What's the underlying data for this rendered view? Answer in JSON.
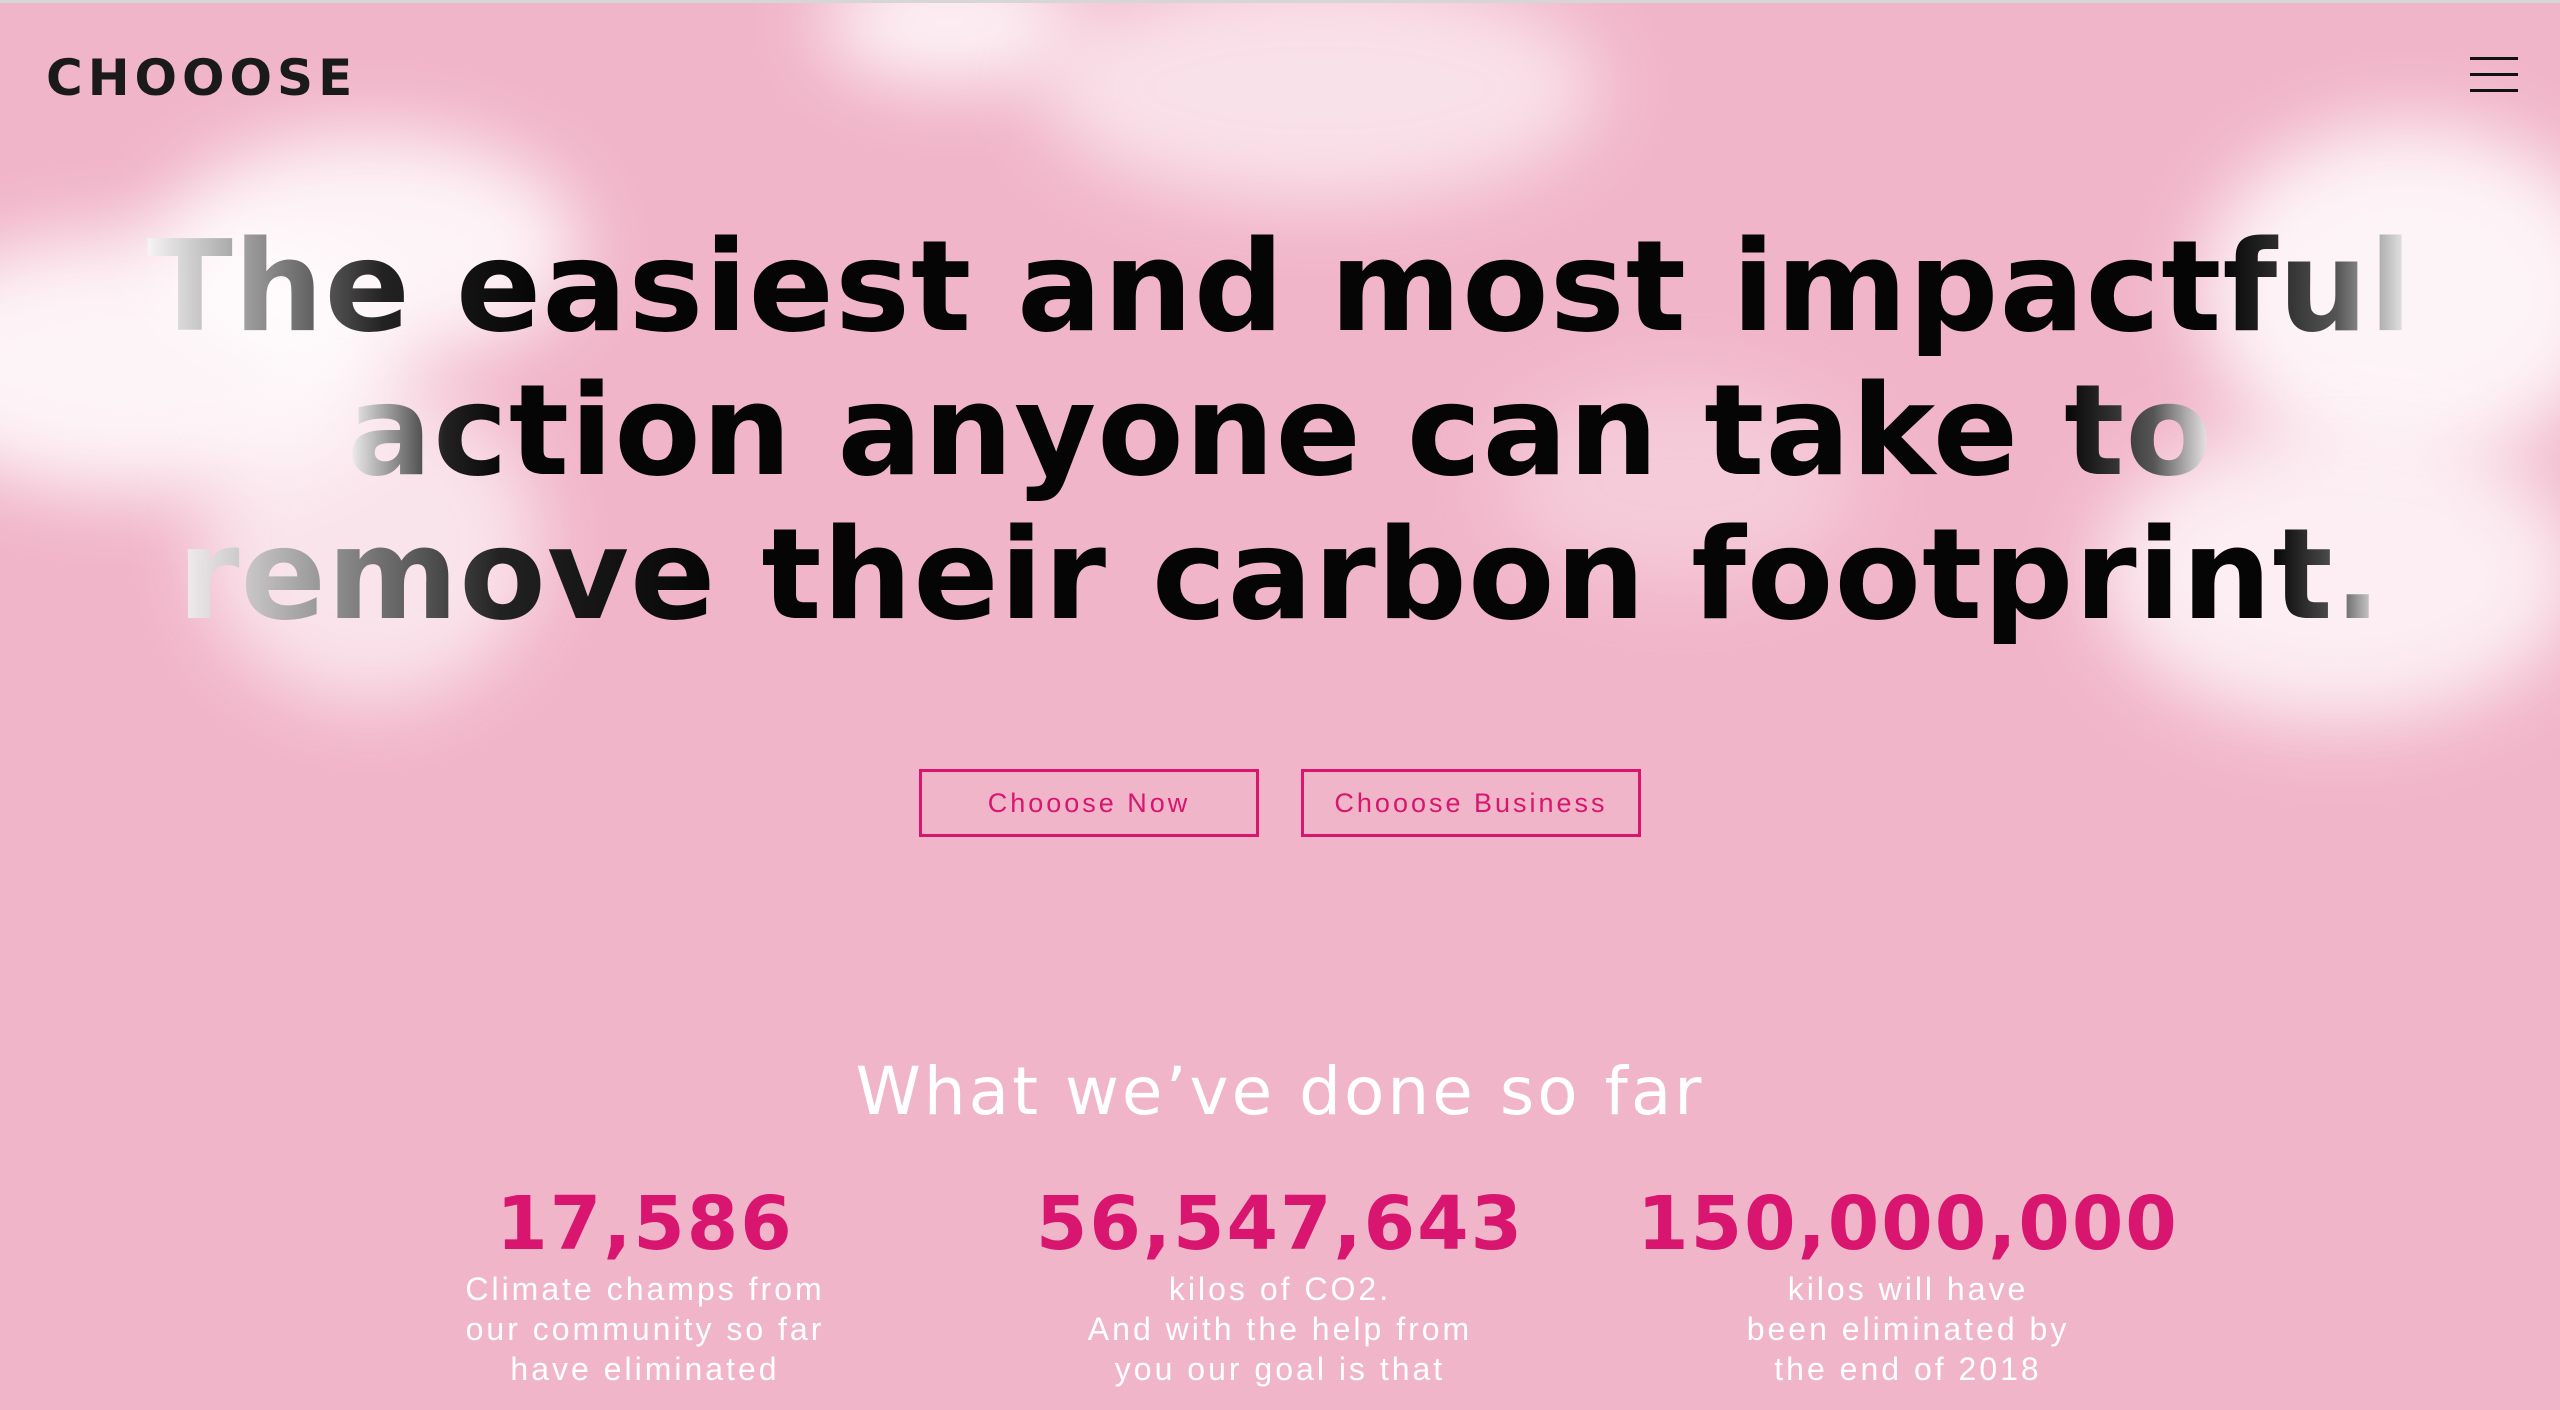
{
  "header": {
    "logo": "CHOOOSE",
    "menu_icon": "hamburger-menu-icon"
  },
  "hero": {
    "title_lines": [
      {
        "left": "The e",
        "mid": "asiest and most impact",
        "right": "ful"
      },
      {
        "left": "ac",
        "mid": "tion anyone can take ",
        "right": "to"
      },
      {
        "left": "remove",
        "mid": " their carbon footprin",
        "right": "t."
      }
    ],
    "buttons": {
      "primary": "Chooose Now",
      "secondary": "Chooose Business"
    }
  },
  "stats": {
    "title": "What we’ve done so far",
    "items": [
      {
        "number": "17,586",
        "lines": [
          "Climate champs from",
          "our community so far",
          "have eliminated"
        ]
      },
      {
        "number": "56,547,643",
        "lines": [
          "kilos of CO2.",
          "And with the help from",
          "you our goal is that"
        ]
      },
      {
        "number": "150,000,000",
        "lines": [
          "kilos will have",
          "been eliminated by",
          "the end of 2018"
        ]
      }
    ]
  },
  "colors": {
    "background": "#f1b5c9",
    "accent": "#d8156f",
    "text_dark": "#050505",
    "text_light": "#ffffff"
  }
}
